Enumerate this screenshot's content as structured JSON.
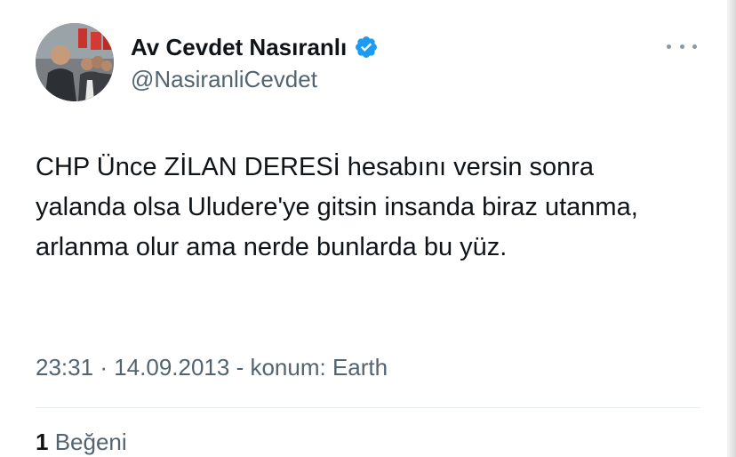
{
  "author": {
    "display_name": "Av Cevdet Nasıranlı",
    "handle": "@NasiranliCevdet",
    "verified_icon": "verified-badge-icon",
    "accent_color": "#1d9bf0"
  },
  "tweet": {
    "text": "CHP Ünce ZİLAN DERESİ hesabını versin sonra yalanda olsa Uludere'ye gitsin insanda biraz utanma, arlanma olur ama nerde bunlarda bu yüz.",
    "time": "23:31",
    "separator": "·",
    "date": "14.09.2013",
    "location": "- konum: Earth"
  },
  "stats": {
    "likes_count": "1",
    "likes_label": "Beğeni"
  },
  "menu": {
    "icon": "more-horizontal-icon"
  }
}
